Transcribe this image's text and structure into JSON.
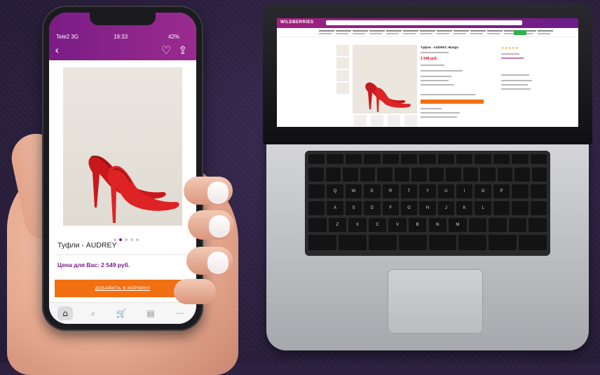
{
  "phone": {
    "status": {
      "carrier": "Tele2 3G",
      "time": "19:33",
      "battery": "42%"
    },
    "header": {
      "back_icon": "back-arrow-icon",
      "fav_icon": "heart-icon",
      "share_icon": "share-icon"
    },
    "product": {
      "title": "Туфли - AUDREY",
      "price": "Цена для Вас: 2 549 руб.",
      "add_to_cart": "ДОБАВИТЬ В КОРЗИНУ",
      "image_slide_dots": 5,
      "active_dot": 2
    },
    "tabbar": [
      "home-icon",
      "search-icon",
      "cart-icon",
      "catalog-icon",
      "more-icon"
    ],
    "colors": {
      "header": "#7b1c86",
      "cta": "#f26f12",
      "price": "#7b1c86"
    }
  },
  "laptop": {
    "site": {
      "logo": "WILDBERRIES",
      "product_title": "Туфли - AUDREY, Mango",
      "product_price": "2 549 руб.",
      "colors": {
        "header": "#a1207f",
        "cta": "#f26f12",
        "price": "#d0021b"
      }
    }
  }
}
